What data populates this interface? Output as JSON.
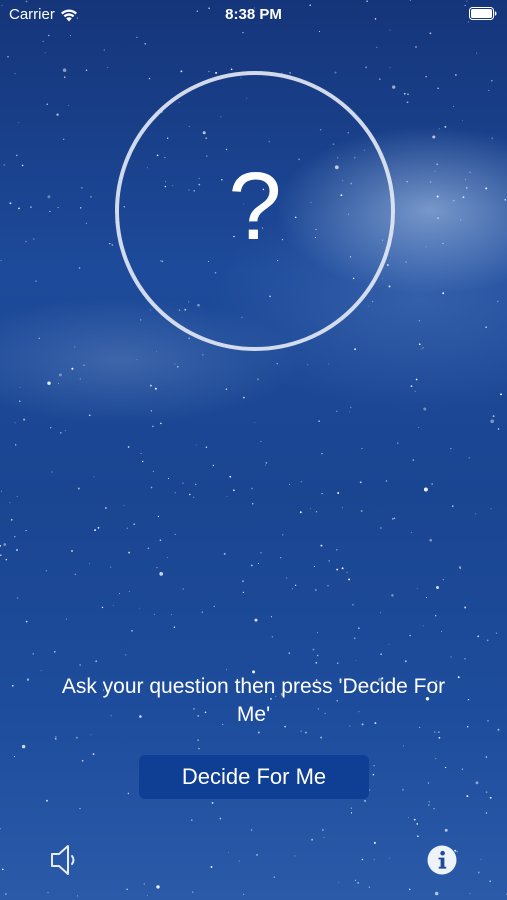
{
  "status_bar": {
    "carrier": "Carrier",
    "time": "8:38 PM"
  },
  "answer": {
    "symbol": "?"
  },
  "instructions": "Ask your question then press 'Decide For Me'",
  "decide_button": {
    "label": "Decide For Me"
  },
  "icons": {
    "wifi": "wifi-icon",
    "battery": "battery-icon",
    "sound": "speaker-icon",
    "info": "info-icon"
  },
  "colors": {
    "button_bg": "#0f3f95",
    "circle_stroke": "#e6ebf5",
    "text": "#ffffff"
  }
}
